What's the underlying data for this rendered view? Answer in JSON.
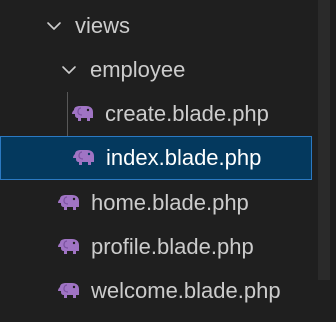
{
  "explorer": {
    "items": [
      {
        "label": "views",
        "type": "folder",
        "expanded": true
      },
      {
        "label": "employee",
        "type": "folder",
        "expanded": true
      },
      {
        "label": "create.blade.php",
        "type": "file"
      },
      {
        "label": "index.blade.php",
        "type": "file",
        "selected": true
      },
      {
        "label": "home.blade.php",
        "type": "file"
      },
      {
        "label": "profile.blade.php",
        "type": "file"
      },
      {
        "label": "welcome.blade.php",
        "type": "file"
      }
    ],
    "icons": {
      "folder_chevron": "chevron-down-icon",
      "file": "php-elephant-icon"
    },
    "colors": {
      "background": "#1f1f1f",
      "selection_background": "#04395e",
      "selection_border": "#2b79c2",
      "php_icon": "#a074c4",
      "text": "#cccccc"
    }
  }
}
